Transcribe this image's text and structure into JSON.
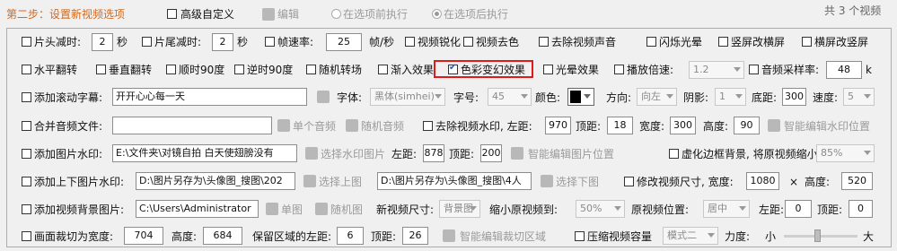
{
  "header": {
    "step_title": "第二步：设置新视频选项",
    "advanced_custom": "高级自定义",
    "edit": "编辑",
    "before_exec": "在选项前执行",
    "after_exec": "在选项后执行",
    "total": "共 3 个视频"
  },
  "row1": {
    "head_cut": "片头减时:",
    "head_val": "2",
    "sec1": "秒",
    "tail_cut": "片尾减时:",
    "tail_val": "2",
    "sec2": "秒",
    "framerate": "帧速率:",
    "framerate_val": "25",
    "fps_unit": "帧/秒",
    "sharpen": "视频锐化",
    "deduplicate": "视频去色",
    "remove_audio": "去除视频声音",
    "flash": "闪烁光晕",
    "vertical_to_horizontal": "竖屏改横屏",
    "horizontal_to_vertical": "横屏改竖屏"
  },
  "row2": {
    "hflip": "水平翻转",
    "vflip": "垂直翻转",
    "rot90cw": "顺时90度",
    "rot90ccw": "逆时90度",
    "random_transition": "随机转场",
    "fade_in": "渐入效果",
    "color_effect": "色彩变幻效果",
    "glow": "光晕效果",
    "speed": "播放倍速:",
    "speed_val": "1.2",
    "sample_rate": "音频采样率:",
    "sample_val": "48",
    "sample_unit": "k"
  },
  "row3": {
    "scroll_text": "添加滚动字幕:",
    "scroll_val": "开开心心每一天",
    "font_label": "字体:",
    "font_val": "黑体(simhei)",
    "size_label": "字号:",
    "size_val": "45",
    "color_label": "颜色:",
    "direction_label": "方向:",
    "direction_val": "向左",
    "shadow_label": "阴影:",
    "shadow_val": "1",
    "bottom_label": "底距:",
    "bottom_val": "300",
    "speed_label": "速度:",
    "speed_val": "5"
  },
  "row4": {
    "merge_audio": "合并音频文件:",
    "single_audio": "单个音频",
    "random_audio": "随机音频",
    "remove_watermark": "去除视频水印, 左距:",
    "left_val": "970",
    "top_label": "顶距:",
    "top_val": "18",
    "width_label": "宽度:",
    "width_val": "300",
    "height_label": "高度:",
    "height_val": "90",
    "smart_edit": "智能编辑水印位置"
  },
  "row5": {
    "img_watermark": "添加图片水印:",
    "img_path": "E:\\文件夹\\对镜自拍 白天使翅膀没有",
    "select_img": "选择水印图片",
    "left_label": "左距:",
    "left_val": "878",
    "top_label": "顶距:",
    "top_val": "200",
    "smart_edit_img": "智能编辑图片位置",
    "virtual_border": "虚化边框背景, 将原视频缩小到:",
    "scale_val": "85%"
  },
  "row6": {
    "top_bottom_img": "添加上下图片水印:",
    "top_path": "D:\\图片另存为\\头像图_搜图\\202",
    "select_top": "选择上图",
    "bottom_path": "D:\\图片另存为\\头像图_搜图\\4人",
    "select_bottom": "选择下图",
    "resize": "修改视频尺寸, 宽度:",
    "width_val": "1080",
    "times": "×",
    "height_label": "高度:",
    "height_val": "520"
  },
  "row7": {
    "bg_img": "添加视频背景图片:",
    "bg_path": "C:\\Users\\Administrator",
    "single_img": "单图",
    "random_img": "随机图",
    "new_size": "新视频尺寸:",
    "new_size_val": "背景图",
    "shrink": "缩小原视频到:",
    "shrink_val": "50%",
    "position": "原视频位置:",
    "position_val": "居中",
    "left_label": "左距:",
    "left_val": "0",
    "top_label": "顶距:",
    "top_val": "0"
  },
  "row8": {
    "crop": "画面裁切为宽度:",
    "crop_w": "704",
    "height_label": "高度:",
    "crop_h": "684",
    "keep_left": "保留区域的左距:",
    "keep_left_val": "6",
    "top_label": "顶距:",
    "top_val": "26",
    "smart_crop": "智能编辑裁切区域",
    "compress": "压缩视频容量",
    "mode_val": "模式二",
    "strength": "力度:",
    "small": "小",
    "large": "大",
    "strength_level": 0.45
  },
  "colors": {
    "step_title": "#d2691e",
    "highlight": "#e01a1a",
    "accent": "#1a5fb4"
  }
}
